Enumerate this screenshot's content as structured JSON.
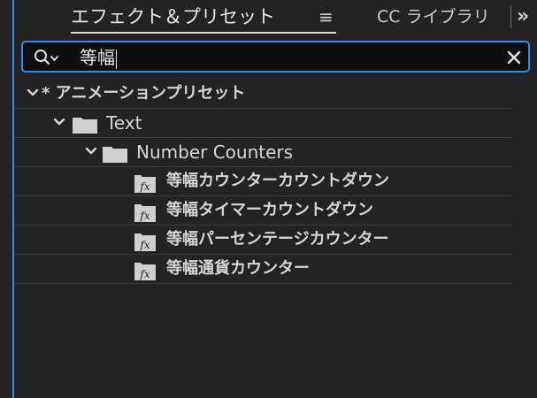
{
  "tabs": {
    "active_label": "エフェクト＆プリセット",
    "menu_glyph": "≡",
    "next_label": "CC ライブラリ",
    "overflow_glyph": "»"
  },
  "search": {
    "value": "等幅",
    "icon": "search-icon",
    "clear_icon": "close-icon"
  },
  "tree": {
    "root": {
      "label": "* アニメーションプリセット",
      "icon": "chevron-down-icon"
    },
    "folder1": {
      "label": "Text",
      "icon": "folder-icon"
    },
    "folder2": {
      "label": "Number Counters",
      "icon": "folder-icon"
    },
    "items": [
      {
        "label": "等幅カウンターカウントダウン",
        "icon": "fx-icon"
      },
      {
        "label": "等幅タイマーカウントダウン",
        "icon": "fx-icon"
      },
      {
        "label": "等幅パーセンテージカウンター",
        "icon": "fx-icon"
      },
      {
        "label": "等幅通貨カウンター",
        "icon": "fx-icon"
      }
    ]
  },
  "colors": {
    "accent": "#2d8ceb",
    "panel_bg": "#232323",
    "search_bg": "#0f0f0f"
  }
}
